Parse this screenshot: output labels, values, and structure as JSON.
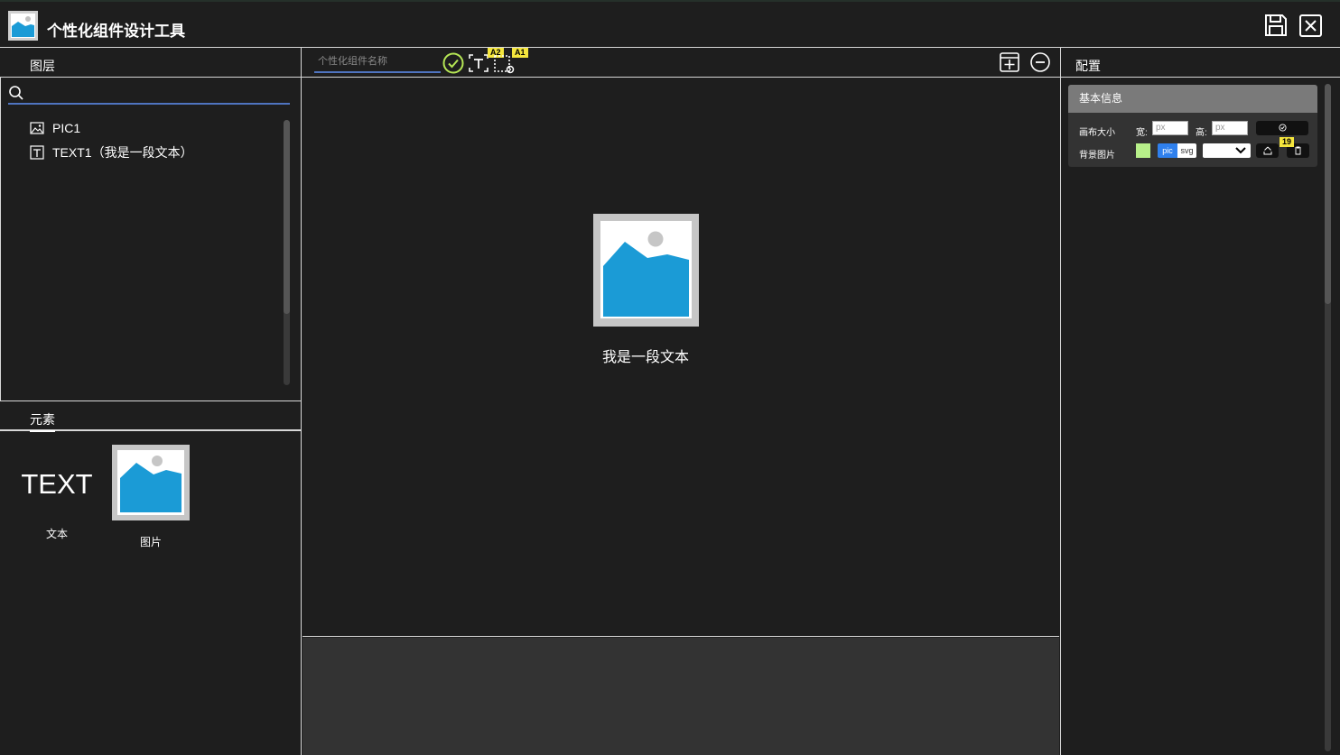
{
  "app": {
    "title": "个性化组件设计工具",
    "logo_icon": "image-icon",
    "actions": {
      "save_icon": "save-icon",
      "close_icon": "close-icon"
    }
  },
  "layers": {
    "title": "图层",
    "search_placeholder": "",
    "items": [
      {
        "icon": "image-icon",
        "label": "PIC1"
      },
      {
        "icon": "text-icon",
        "label": "TEXT1（我是一段文本）"
      }
    ]
  },
  "elements": {
    "tab_label": "元素",
    "items": [
      {
        "preview_text": "TEXT",
        "label": "文本"
      },
      {
        "preview_icon": "image-placeholder-icon",
        "label": "图片"
      }
    ]
  },
  "toolbar": {
    "name_placeholder": "个性化组件名称",
    "badges": {
      "text_tool": "A2",
      "pic_tool": "A1"
    }
  },
  "canvas": {
    "text": "我是一段文本"
  },
  "config": {
    "title": "配置",
    "basic_info": {
      "title": "基本信息",
      "canvas_size_label": "画布大小",
      "width_label": "宽:",
      "height_label": "高:",
      "width_placeholder": "px",
      "height_placeholder": "px",
      "bg_image_label": "背景图片",
      "pic_option": "pic",
      "svg_option": "svg",
      "count_badge": "19",
      "bg_color": "#b8f08a"
    }
  },
  "colors": {
    "accent_blue": "#4f74c0",
    "confirm_green": "#b5e655",
    "badge_yellow": "#f5e63d",
    "image_blue": "#1b9bd6"
  }
}
